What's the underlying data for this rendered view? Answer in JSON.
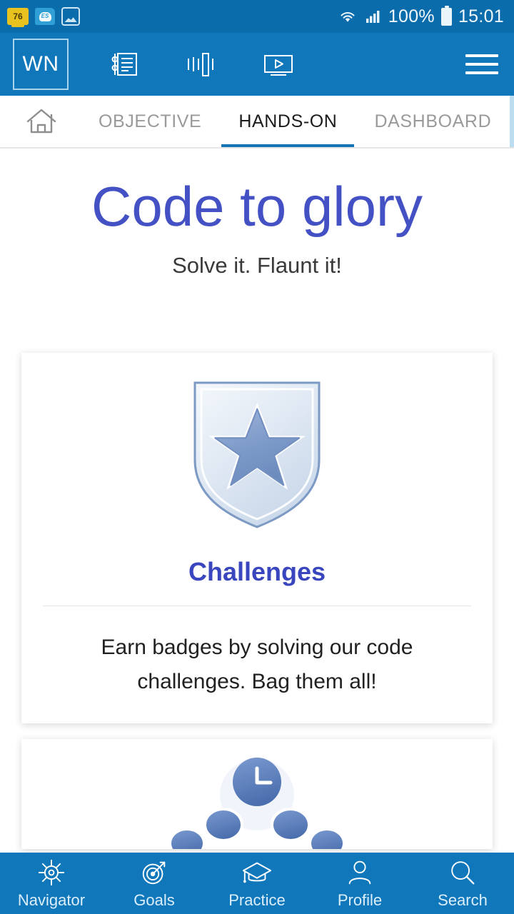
{
  "statusbar": {
    "left_icons": [
      {
        "name": "sd-card-storage-icon",
        "label": "76"
      },
      {
        "name": "es-file-explorer-icon",
        "label": "ES"
      },
      {
        "name": "gallery-icon",
        "label": ""
      }
    ],
    "wifi_icon": "wifi-icon",
    "signal_icon": "cellular-signal-icon",
    "battery_percent": "100%",
    "battery_icon": "battery-full-icon",
    "time": "15:01"
  },
  "appbar": {
    "logo": "WN",
    "icons": [
      {
        "name": "article-notebook-icon"
      },
      {
        "name": "audio-waveform-icon"
      },
      {
        "name": "video-player-icon"
      }
    ],
    "menu_icon": "hamburger-menu-icon"
  },
  "tabs": {
    "home_icon": "home-icon",
    "items": [
      {
        "label": "OBJECTIVE",
        "active": false
      },
      {
        "label": "HANDS-ON",
        "active": true
      },
      {
        "label": "DASHBOARD",
        "active": false
      }
    ],
    "next_icon": "chevron-right-icon"
  },
  "page": {
    "title": "Code to glory",
    "subtitle": "Solve it. Flaunt it!"
  },
  "cards": [
    {
      "media_icon": "shield-star-badge-icon",
      "title": "Challenges",
      "description": "Earn badges by solving our code challenges. Bag them all!"
    },
    {
      "media_icon": "clock-network-icon",
      "title": "",
      "description": ""
    }
  ],
  "bottomnav": {
    "items": [
      {
        "icon": "ship-wheel-icon",
        "label": "Navigator"
      },
      {
        "icon": "target-dartboard-icon",
        "label": "Goals"
      },
      {
        "icon": "graduation-cap-icon",
        "label": "Practice"
      },
      {
        "icon": "person-profile-icon",
        "label": "Profile"
      },
      {
        "icon": "search-magnifier-icon",
        "label": "Search"
      }
    ]
  },
  "colors": {
    "statusbar": "#0b6cab",
    "appbar": "#1177bb",
    "accent_blue": "#1474b4",
    "tab_next_bg": "#bcdcf0",
    "title_purple": "#4351c4",
    "card_title_blue": "#3a46bd"
  }
}
